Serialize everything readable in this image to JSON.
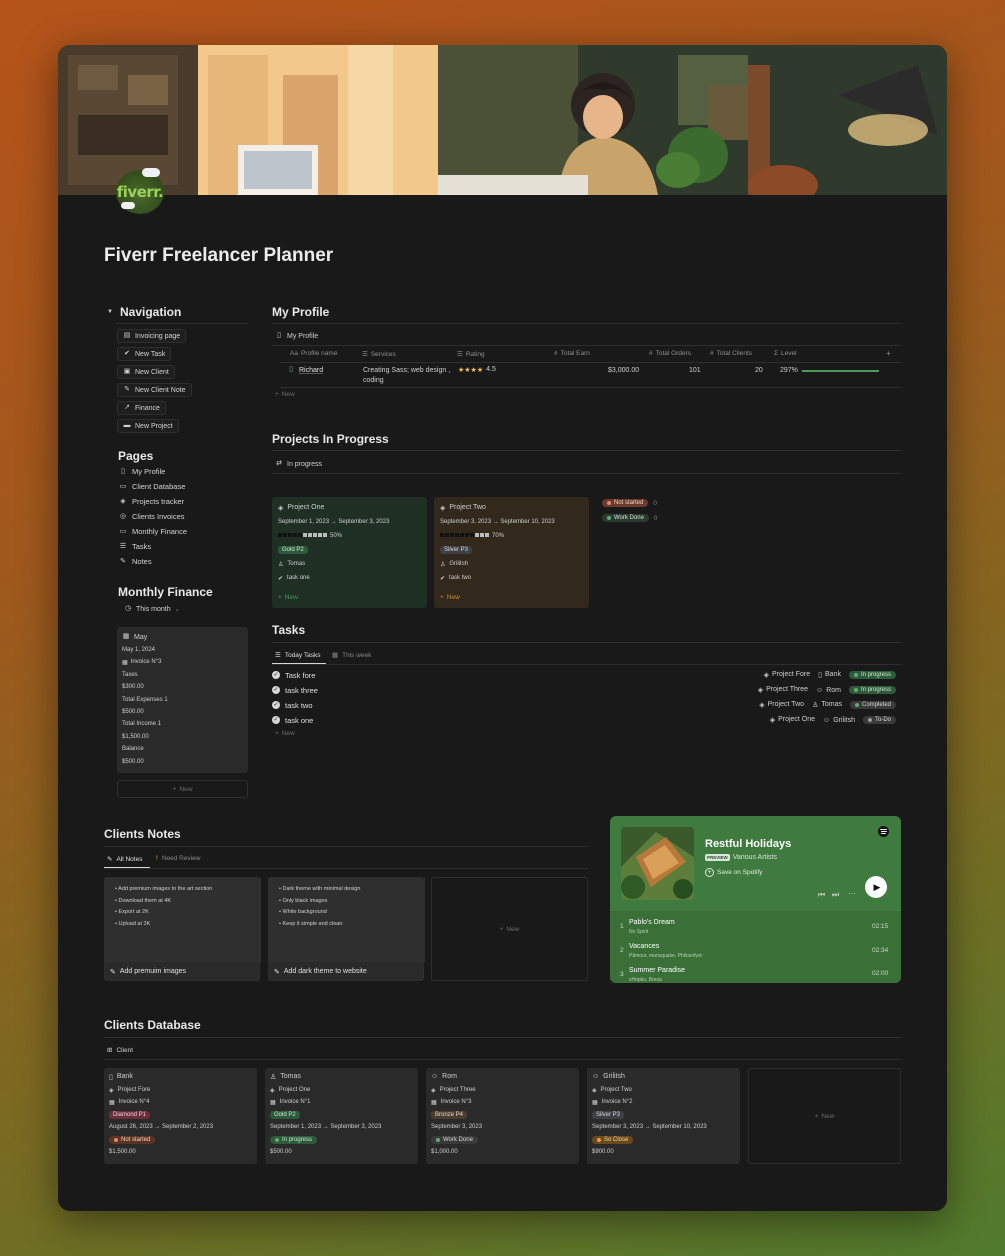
{
  "page": {
    "title": "Fiverr Freelancer Planner",
    "logo_text": "fiverr."
  },
  "navigation": {
    "heading": "Navigation",
    "buttons": [
      "Invoicing page",
      "New Task",
      "New Client",
      "New Client Note",
      "Finance",
      "New Project"
    ]
  },
  "pages": {
    "heading": "Pages",
    "items": [
      "My Profile",
      "Client Database",
      "Projects tracker",
      "Clients Invoices",
      "Monthly Finance",
      "Tasks",
      "Notes"
    ]
  },
  "monthly_finance": {
    "heading": "Monthly Finance",
    "filter": "This month",
    "card": {
      "title": "May",
      "date": "May 1, 2024",
      "invoice": "Invoice N°3",
      "taxes_label": "Taxes",
      "taxes": "$300.00",
      "expenses_label": "Total Expenses 1",
      "expenses": "$500.00",
      "income_label": "Total Income 1",
      "income": "$1,500.00",
      "balance_label": "Balance",
      "balance": "$500.00"
    },
    "new_label": "New"
  },
  "profile": {
    "heading": "My Profile",
    "view": "My Profile",
    "columns": [
      "Profile name",
      "Services",
      "Rating",
      "Total Earn",
      "Total Orders",
      "Total Clients",
      "Level"
    ],
    "row": {
      "name": "Richard",
      "services_line1": "Creating Sass; web design ,",
      "services_line2": "coding",
      "rating_stars": "★★★★",
      "rating": "4.5",
      "earn": "$3,000.00",
      "orders": "101",
      "clients": "20",
      "level": "297%",
      "level_fraction": 1.0
    },
    "new_label": "New"
  },
  "projects": {
    "heading": "Projects In Progress",
    "view": "In progress",
    "cards": [
      {
        "name": "Project One",
        "dates": "September 1, 2023 → September 3, 2023",
        "progress": "50%",
        "progress_fraction": 0.5,
        "tier": "Gold P2",
        "person": "Tomas",
        "task": "task one"
      },
      {
        "name": "Project Two",
        "dates": "September 3, 2023 → September 10, 2023",
        "progress": "70%",
        "progress_fraction": 0.7,
        "tier": "Silver P3",
        "person": "Grilitsh",
        "task": "task two"
      }
    ],
    "new_label": "New",
    "groups": [
      {
        "label": "Not started",
        "count": "0"
      },
      {
        "label": "Work Done",
        "count": "0"
      }
    ]
  },
  "tasks": {
    "heading": "Tasks",
    "tabs": [
      "Today Tasks",
      "This week"
    ],
    "rows": [
      {
        "name": "Task fore",
        "project": "Project Fore",
        "client": "Bank",
        "status": "In progress"
      },
      {
        "name": "task three",
        "project": "Project Three",
        "client": "Rom",
        "status": "In progress"
      },
      {
        "name": "task two",
        "project": "Project Two",
        "client": "Tomas",
        "status": "Completed"
      },
      {
        "name": "task one",
        "project": "Project One",
        "client": "Grilitsh",
        "status": "To-Do"
      }
    ],
    "new_label": "New"
  },
  "clients_notes": {
    "heading": "Clients Notes",
    "tabs": [
      "All Notes",
      "Need Review"
    ],
    "notes": [
      {
        "bullets": [
          "Add premium images to the art section",
          "Download them at 4K",
          "Export at 2K",
          "Upload at 3K"
        ],
        "title": "Add premuim images"
      },
      {
        "bullets": [
          "Dark theme with minimal design",
          "Only black images",
          "White background",
          "Keep it simple and clean"
        ],
        "title": "Add dark theme to website"
      }
    ],
    "new_label": "New"
  },
  "spotify": {
    "title": "Restful Holidays",
    "badge": "PREVIEW",
    "artist": "Various Artists",
    "save": "Save on Spotify",
    "tracks": [
      {
        "num": "1",
        "name": "Pablo's Dream",
        "artist": "No Spirit",
        "time": "02:15"
      },
      {
        "num": "2",
        "name": "Vacances",
        "artist": "Pâmour, mansquake, Philosofyst",
        "time": "02:34"
      },
      {
        "num": "3",
        "name": "Summer Paradise",
        "artist": "xHopko, Brexa",
        "time": "02:00"
      }
    ]
  },
  "clients_db": {
    "heading": "Clients Database",
    "view": "Client",
    "cards": [
      {
        "name": "Bank",
        "project": "Project Fore",
        "invoice": "Invoice N°4",
        "tier": "Diamond P1",
        "dates": "August 26, 2023 → September 2, 2023",
        "status": "Not started",
        "amount": "$1,500.00"
      },
      {
        "name": "Tomas",
        "project": "Project One",
        "invoice": "Invoice N°1",
        "tier": "Gold P2",
        "dates": "September 1, 2023 → September 3, 2023",
        "status": "In progress",
        "amount": "$500.00"
      },
      {
        "name": "Rom",
        "project": "Project Three",
        "invoice": "Invoice N°3",
        "tier": "Bronze P4",
        "dates": "September 3, 2023",
        "status": "Work Done",
        "amount": "$1,000.00"
      },
      {
        "name": "Grilitsh",
        "project": "Project Two",
        "invoice": "Invoice N°2",
        "tier": "Silver P3",
        "dates": "September 3, 2023 → September 10, 2023",
        "status": "So Close",
        "amount": "$900.00"
      }
    ],
    "new_label": "New"
  },
  "colors": {
    "green_card": "#1f2f24",
    "brown_card": "#33281c",
    "tag_green": "#2c5a3a",
    "tag_red": "#6a2f3a",
    "spotify_green": "#3f7a3f",
    "accent_green": "#4c9a5a"
  }
}
